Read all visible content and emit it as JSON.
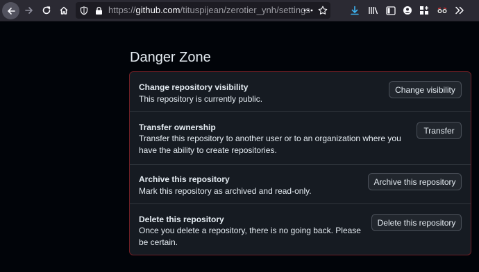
{
  "browser": {
    "url_prefix": "https://",
    "url_host": "github.com",
    "url_path": "/tituspijean/zerotier_ynh/settings"
  },
  "icons": {
    "back": "back-arrow-icon",
    "forward": "forward-arrow-icon",
    "reload": "reload-icon",
    "home": "home-icon",
    "shield": "shield-icon",
    "lock": "lock-icon",
    "more": "ellipsis-icon",
    "bookmark": "star-icon",
    "download": "download-icon",
    "library": "library-icon",
    "sidebar": "sidebar-icon",
    "account": "account-icon",
    "extensions": "extensions-grid-icon",
    "extension": "glasses-icon",
    "overflow": "chevron-double-right-icon"
  },
  "colors": {
    "accent_download": "#3db4f2",
    "danger_border": "#6e1f25"
  },
  "danger_zone": {
    "title": "Danger Zone",
    "items": [
      {
        "title": "Change repository visibility",
        "description": "This repository is currently public.",
        "button": "Change visibility"
      },
      {
        "title": "Transfer ownership",
        "description": "Transfer this repository to another user or to an organization where you have the ability to create repositories.",
        "button": "Transfer"
      },
      {
        "title": "Archive this repository",
        "description": "Mark this repository as archived and read-only.",
        "button": "Archive this repository"
      },
      {
        "title": "Delete this repository",
        "description": "Once you delete a repository, there is no going back. Please be certain.",
        "button": "Delete this repository"
      }
    ]
  }
}
